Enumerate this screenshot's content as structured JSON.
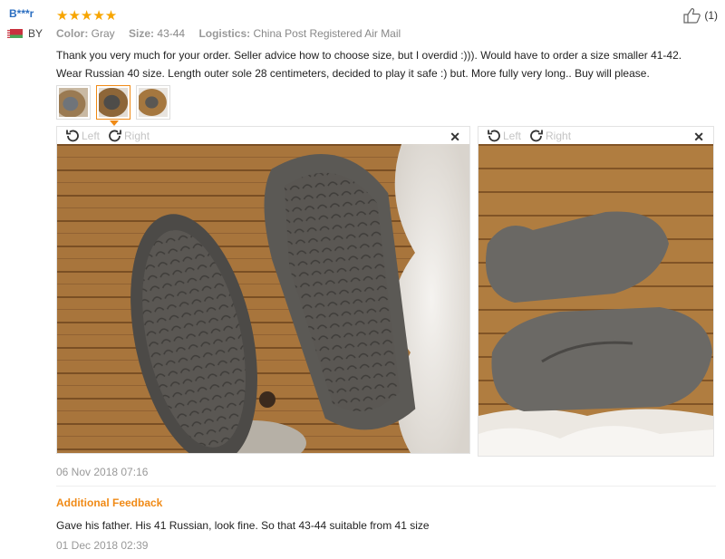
{
  "user": {
    "name": "B***r",
    "country": "BY"
  },
  "rating": {
    "stars": 5,
    "glyphs": "★★★★★"
  },
  "helpful": {
    "count": "(1)"
  },
  "attributes": [
    {
      "key": "Color:",
      "value": "Gray"
    },
    {
      "key": "Size:",
      "value": "43-44"
    },
    {
      "key": "Logistics:",
      "value": "China Post Registered Air Mail"
    }
  ],
  "review_text": "Thank you very much for your order. Seller advice how to choose size, but I overdid :))). Would have to order a size smaller 41-42. Wear Russian 40 size. Length outer sole 28 centimeters, decided to play it safe :) but. More fully very long.. Buy will please.",
  "viewer": {
    "left_label": "Left",
    "right_label": "Right",
    "close_glyph": "✕"
  },
  "review_date": "06 Nov 2018 07:16",
  "additional": {
    "heading": "Additional Feedback",
    "text": "Gave his father. His 41 Russian, look fine. So that 43-44 suitable from 41 size",
    "date": "01 Dec 2018 02:39"
  },
  "colors": {
    "accent": "#f08a16",
    "star": "#f7a500",
    "username": "#2c6fc1"
  }
}
